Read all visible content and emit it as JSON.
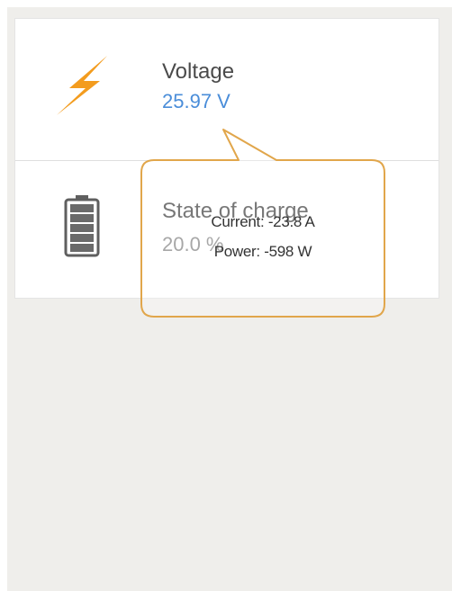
{
  "rows": [
    {
      "label": "Voltage",
      "value": "25.97 V",
      "icon": "lightning-bolt-icon",
      "value_color": "#4a8dd9"
    },
    {
      "label": "State of charge",
      "value": "20.0 %",
      "icon": "battery-icon",
      "value_color": "#8a8a8a"
    }
  ],
  "tooltip": {
    "current": "Current: -23.8 A",
    "power": "Power: -598 W",
    "border_color": "#e1a64b"
  },
  "colors": {
    "accent": "#f39c1e",
    "panel_bg": "#ffffff",
    "page_bg": "#efeeeb",
    "icon_gray": "#5f5f5f"
  }
}
